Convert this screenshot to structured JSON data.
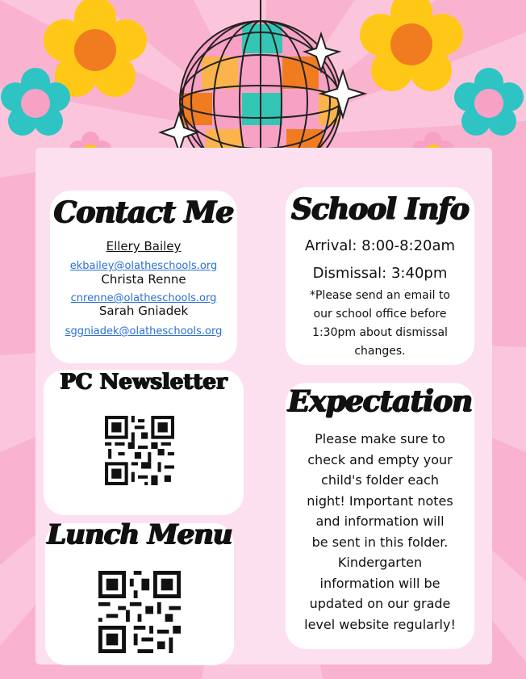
{
  "contact": {
    "heading": "Contact Me",
    "name1": "Ellery Bailey",
    "email1": "ekbailey@olatheschools.org",
    "name2": "Christa Renne",
    "email2": "cnrenne@olatheschools.org",
    "name3": "Sarah Gniadek",
    "email3": "sggniadek@olatheschools.org"
  },
  "school": {
    "heading": "School Info",
    "arrival": "Arrival: 8:00-8:20am",
    "dismissal": "Dismissal: 3:40pm",
    "note_lines": [
      "*Please send an email to",
      "our school office before",
      "1:30pm about dismissal",
      "changes."
    ]
  },
  "newsletter": {
    "heading": "PC Newsletter"
  },
  "expectation": {
    "heading": "Expectation",
    "lines": [
      "Please make sure to",
      "check and empty your",
      "child's folder each",
      "night! Important notes",
      "and information will",
      "be sent in this folder.",
      "Kindergarten",
      "information will be",
      "updated on our grade",
      "level website regularly!"
    ]
  },
  "lunch": {
    "heading": "Lunch Menu"
  },
  "colors": {
    "background": "#f9b3cf",
    "panel": "#fde0ef",
    "flower_orange": "#ffc817",
    "flower_teal": "#2ec4c4",
    "disco_pink": "#f7a1c4",
    "disco_orange": "#f07c1f",
    "link": "#2a6fd6"
  }
}
